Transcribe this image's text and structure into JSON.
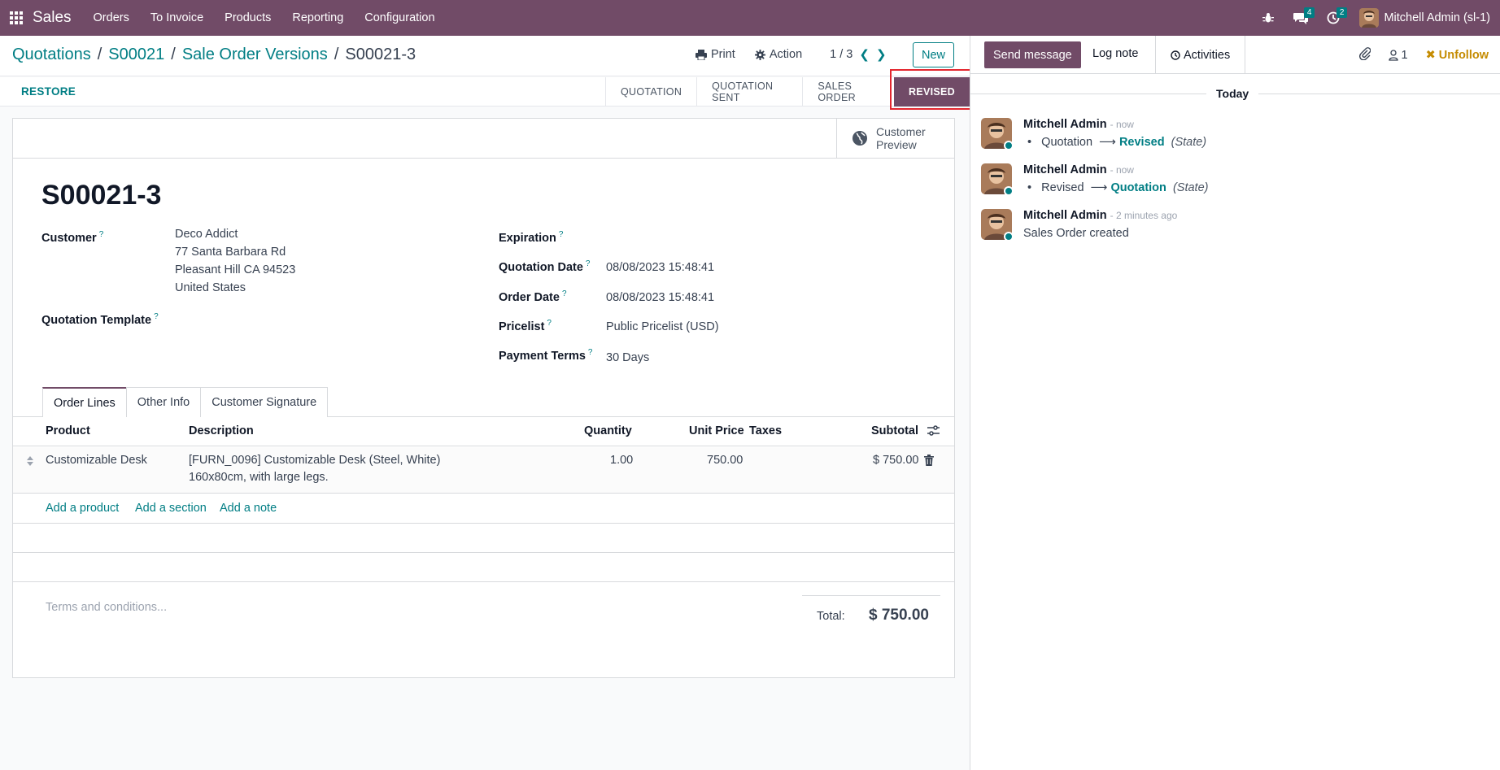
{
  "navbar": {
    "app_name": "Sales",
    "menu": [
      "Orders",
      "To Invoice",
      "Products",
      "Reporting",
      "Configuration"
    ],
    "messages_count": "4",
    "activities_count": "2",
    "user": "Mitchell Admin (sl-1)",
    "icons": [
      "apps-grid-icon",
      "bug-icon",
      "chat-icon",
      "clock-icon"
    ],
    "bg_color": "#714b67"
  },
  "breadcrumb": {
    "items": [
      "Quotations",
      "S00021",
      "Sale Order Versions"
    ],
    "current": "S00021-3"
  },
  "control": {
    "print": "Print",
    "action": "Action",
    "pager": "1 / 3",
    "new": "New"
  },
  "statusbar": {
    "restore": "RESTORE",
    "stages": [
      "QUOTATION",
      "QUOTATION SENT",
      "SALES ORDER",
      "REVISED"
    ],
    "active_stage": "REVISED"
  },
  "form": {
    "preview_line1": "Customer",
    "preview_line2": "Preview",
    "name": "S00021-3",
    "customer_label": "Customer",
    "customer_lines": [
      "Deco Addict",
      "77 Santa Barbara Rd",
      "Pleasant Hill CA 94523",
      "United States"
    ],
    "template_label": "Quotation Template",
    "expiration_label": "Expiration",
    "quotation_date_label": "Quotation Date",
    "quotation_date": "08/08/2023 15:48:41",
    "order_date_label": "Order Date",
    "order_date": "08/08/2023 15:48:41",
    "pricelist_label": "Pricelist",
    "pricelist": "Public Pricelist (USD)",
    "payment_terms_label": "Payment Terms",
    "payment_terms": "30 Days",
    "help_mark": "?"
  },
  "tabs": [
    "Order Lines",
    "Other Info",
    "Customer Signature"
  ],
  "order_lines": {
    "headers": {
      "product": "Product",
      "description": "Description",
      "quantity": "Quantity",
      "unit_price": "Unit Price",
      "taxes": "Taxes",
      "subtotal": "Subtotal"
    },
    "rows": [
      {
        "product": "Customizable Desk",
        "description_1": "[FURN_0096] Customizable Desk (Steel, White)",
        "description_2": "160x80cm, with large legs.",
        "quantity": "1.00",
        "unit_price": "750.00",
        "taxes": "",
        "subtotal": "$ 750.00"
      }
    ],
    "add_product": "Add a product",
    "add_section": "Add a section",
    "add_note": "Add a note"
  },
  "footer": {
    "terms_placeholder": "Terms and conditions...",
    "total_label": "Total:",
    "total_value": "$ 750.00"
  },
  "chatter": {
    "send_message": "Send message",
    "log_note": "Log note",
    "activities": "Activities",
    "followers_count": "1",
    "unfollow": "Unfollow",
    "today": "Today",
    "messages": [
      {
        "author": "Mitchell Admin",
        "date": "- now",
        "old": "Quotation",
        "new": "Revised",
        "field": "(State)"
      },
      {
        "author": "Mitchell Admin",
        "date": "- now",
        "old": "Revised",
        "new": "Quotation",
        "field": "(State)"
      },
      {
        "author": "Mitchell Admin",
        "date": "- 2 minutes ago",
        "body": "Sales Order created"
      }
    ]
  },
  "colors": {
    "brand": "#714b67",
    "accent": "#017e84",
    "unfollow": "#c58c02",
    "highlight": "#e3262e"
  }
}
